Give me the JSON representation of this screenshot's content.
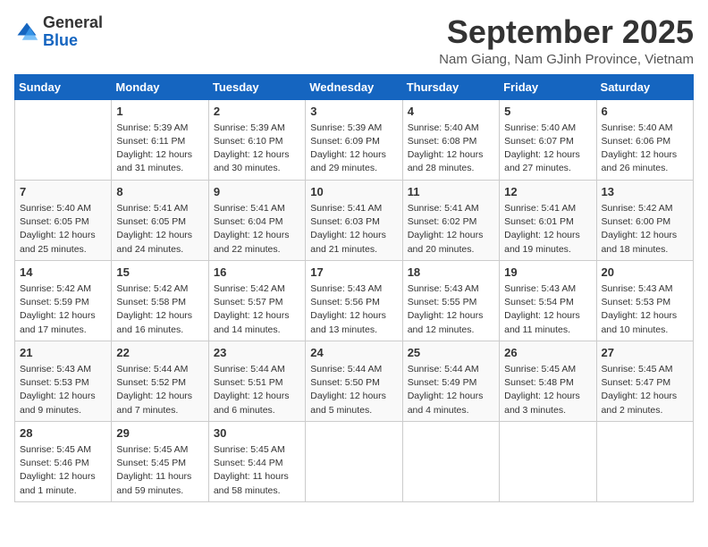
{
  "logo": {
    "general": "General",
    "blue": "Blue"
  },
  "title": "September 2025",
  "location": "Nam Giang, Nam GJinh Province, Vietnam",
  "weekdays": [
    "Sunday",
    "Monday",
    "Tuesday",
    "Wednesday",
    "Thursday",
    "Friday",
    "Saturday"
  ],
  "weeks": [
    [
      {
        "day": "",
        "sunrise": "",
        "sunset": "",
        "daylight": ""
      },
      {
        "day": "1",
        "sunrise": "Sunrise: 5:39 AM",
        "sunset": "Sunset: 6:11 PM",
        "daylight": "Daylight: 12 hours and 31 minutes."
      },
      {
        "day": "2",
        "sunrise": "Sunrise: 5:39 AM",
        "sunset": "Sunset: 6:10 PM",
        "daylight": "Daylight: 12 hours and 30 minutes."
      },
      {
        "day": "3",
        "sunrise": "Sunrise: 5:39 AM",
        "sunset": "Sunset: 6:09 PM",
        "daylight": "Daylight: 12 hours and 29 minutes."
      },
      {
        "day": "4",
        "sunrise": "Sunrise: 5:40 AM",
        "sunset": "Sunset: 6:08 PM",
        "daylight": "Daylight: 12 hours and 28 minutes."
      },
      {
        "day": "5",
        "sunrise": "Sunrise: 5:40 AM",
        "sunset": "Sunset: 6:07 PM",
        "daylight": "Daylight: 12 hours and 27 minutes."
      },
      {
        "day": "6",
        "sunrise": "Sunrise: 5:40 AM",
        "sunset": "Sunset: 6:06 PM",
        "daylight": "Daylight: 12 hours and 26 minutes."
      }
    ],
    [
      {
        "day": "7",
        "sunrise": "Sunrise: 5:40 AM",
        "sunset": "Sunset: 6:05 PM",
        "daylight": "Daylight: 12 hours and 25 minutes."
      },
      {
        "day": "8",
        "sunrise": "Sunrise: 5:41 AM",
        "sunset": "Sunset: 6:05 PM",
        "daylight": "Daylight: 12 hours and 24 minutes."
      },
      {
        "day": "9",
        "sunrise": "Sunrise: 5:41 AM",
        "sunset": "Sunset: 6:04 PM",
        "daylight": "Daylight: 12 hours and 22 minutes."
      },
      {
        "day": "10",
        "sunrise": "Sunrise: 5:41 AM",
        "sunset": "Sunset: 6:03 PM",
        "daylight": "Daylight: 12 hours and 21 minutes."
      },
      {
        "day": "11",
        "sunrise": "Sunrise: 5:41 AM",
        "sunset": "Sunset: 6:02 PM",
        "daylight": "Daylight: 12 hours and 20 minutes."
      },
      {
        "day": "12",
        "sunrise": "Sunrise: 5:41 AM",
        "sunset": "Sunset: 6:01 PM",
        "daylight": "Daylight: 12 hours and 19 minutes."
      },
      {
        "day": "13",
        "sunrise": "Sunrise: 5:42 AM",
        "sunset": "Sunset: 6:00 PM",
        "daylight": "Daylight: 12 hours and 18 minutes."
      }
    ],
    [
      {
        "day": "14",
        "sunrise": "Sunrise: 5:42 AM",
        "sunset": "Sunset: 5:59 PM",
        "daylight": "Daylight: 12 hours and 17 minutes."
      },
      {
        "day": "15",
        "sunrise": "Sunrise: 5:42 AM",
        "sunset": "Sunset: 5:58 PM",
        "daylight": "Daylight: 12 hours and 16 minutes."
      },
      {
        "day": "16",
        "sunrise": "Sunrise: 5:42 AM",
        "sunset": "Sunset: 5:57 PM",
        "daylight": "Daylight: 12 hours and 14 minutes."
      },
      {
        "day": "17",
        "sunrise": "Sunrise: 5:43 AM",
        "sunset": "Sunset: 5:56 PM",
        "daylight": "Daylight: 12 hours and 13 minutes."
      },
      {
        "day": "18",
        "sunrise": "Sunrise: 5:43 AM",
        "sunset": "Sunset: 5:55 PM",
        "daylight": "Daylight: 12 hours and 12 minutes."
      },
      {
        "day": "19",
        "sunrise": "Sunrise: 5:43 AM",
        "sunset": "Sunset: 5:54 PM",
        "daylight": "Daylight: 12 hours and 11 minutes."
      },
      {
        "day": "20",
        "sunrise": "Sunrise: 5:43 AM",
        "sunset": "Sunset: 5:53 PM",
        "daylight": "Daylight: 12 hours and 10 minutes."
      }
    ],
    [
      {
        "day": "21",
        "sunrise": "Sunrise: 5:43 AM",
        "sunset": "Sunset: 5:53 PM",
        "daylight": "Daylight: 12 hours and 9 minutes."
      },
      {
        "day": "22",
        "sunrise": "Sunrise: 5:44 AM",
        "sunset": "Sunset: 5:52 PM",
        "daylight": "Daylight: 12 hours and 7 minutes."
      },
      {
        "day": "23",
        "sunrise": "Sunrise: 5:44 AM",
        "sunset": "Sunset: 5:51 PM",
        "daylight": "Daylight: 12 hours and 6 minutes."
      },
      {
        "day": "24",
        "sunrise": "Sunrise: 5:44 AM",
        "sunset": "Sunset: 5:50 PM",
        "daylight": "Daylight: 12 hours and 5 minutes."
      },
      {
        "day": "25",
        "sunrise": "Sunrise: 5:44 AM",
        "sunset": "Sunset: 5:49 PM",
        "daylight": "Daylight: 12 hours and 4 minutes."
      },
      {
        "day": "26",
        "sunrise": "Sunrise: 5:45 AM",
        "sunset": "Sunset: 5:48 PM",
        "daylight": "Daylight: 12 hours and 3 minutes."
      },
      {
        "day": "27",
        "sunrise": "Sunrise: 5:45 AM",
        "sunset": "Sunset: 5:47 PM",
        "daylight": "Daylight: 12 hours and 2 minutes."
      }
    ],
    [
      {
        "day": "28",
        "sunrise": "Sunrise: 5:45 AM",
        "sunset": "Sunset: 5:46 PM",
        "daylight": "Daylight: 12 hours and 1 minute."
      },
      {
        "day": "29",
        "sunrise": "Sunrise: 5:45 AM",
        "sunset": "Sunset: 5:45 PM",
        "daylight": "Daylight: 11 hours and 59 minutes."
      },
      {
        "day": "30",
        "sunrise": "Sunrise: 5:45 AM",
        "sunset": "Sunset: 5:44 PM",
        "daylight": "Daylight: 11 hours and 58 minutes."
      },
      {
        "day": "",
        "sunrise": "",
        "sunset": "",
        "daylight": ""
      },
      {
        "day": "",
        "sunrise": "",
        "sunset": "",
        "daylight": ""
      },
      {
        "day": "",
        "sunrise": "",
        "sunset": "",
        "daylight": ""
      },
      {
        "day": "",
        "sunrise": "",
        "sunset": "",
        "daylight": ""
      }
    ]
  ]
}
